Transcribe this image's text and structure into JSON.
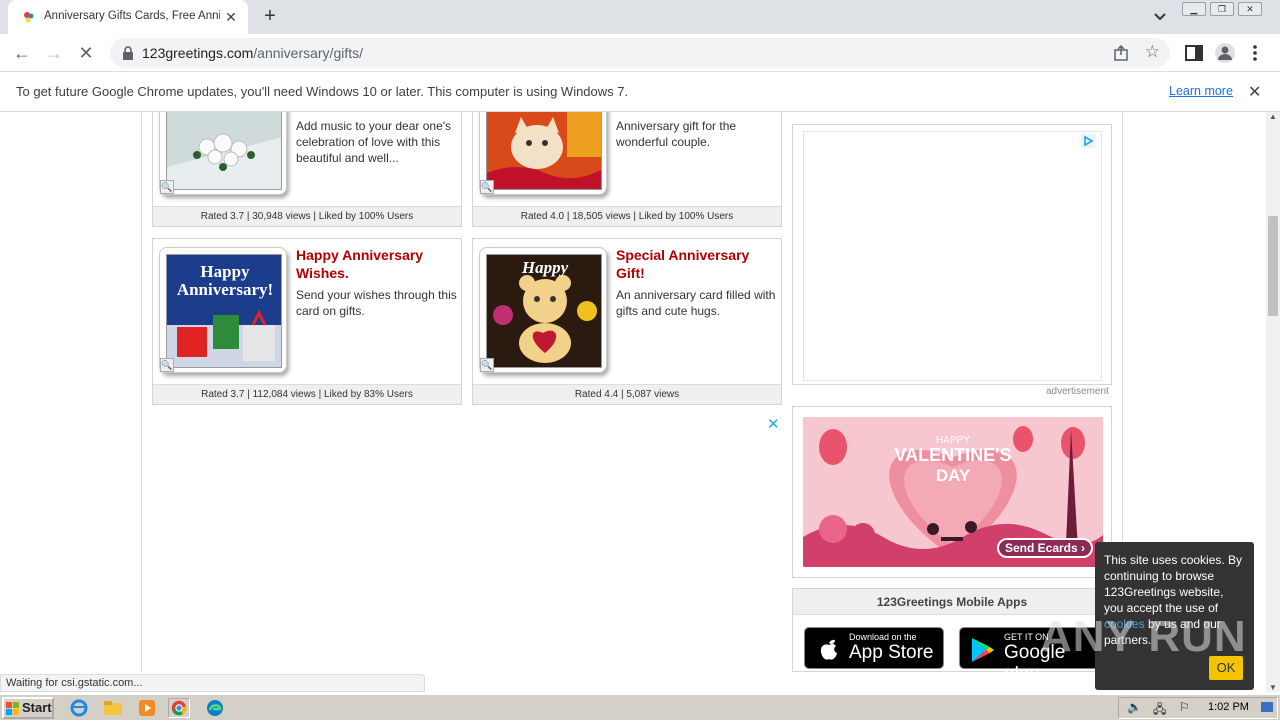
{
  "browser": {
    "tab_title": "Anniversary Gifts Cards, Free Anniv",
    "url_host": "123greetings.com",
    "url_path": "/anniversary/gifts/",
    "infobar_message": "To get future Google Chrome updates, you'll need Windows 10 or later. This computer is using Windows 7.",
    "infobar_link": "Learn more",
    "status_text": "Waiting for csi.gstatic.com..."
  },
  "cards": [
    {
      "title": "",
      "desc": "Add music to your dear one's celebration of love with this beautiful and well...",
      "rating": "Rated 3.7 | 30,948 views | Liked by 100% Users"
    },
    {
      "title": "",
      "desc": "Anniversary gift for the wonderful couple.",
      "rating": "Rated 4.0 | 18,505 views | Liked by 100% Users"
    },
    {
      "title": "Happy Anniversary Wishes.",
      "desc": "Send your wishes through this card on gifts.",
      "rating": "Rated 3.7 | 112,084 views | Liked by 83% Users",
      "thumb_text": "Happy Anniversary!"
    },
    {
      "title": "Special Anniversary Gift!",
      "desc": "An anniversary card filled with gifts and cute hugs.",
      "rating": "Rated 4.4 | 5,087 views",
      "thumb_text": "Happy"
    }
  ],
  "sidebar": {
    "ad_label": "advertisement",
    "valentine": {
      "line1": "HAPPY",
      "line2": "VALENTINE'S",
      "line3": "DAY",
      "button": "Send Ecards ›"
    },
    "apps_heading": "123Greetings Mobile Apps",
    "appstore_small": "Download on the",
    "appstore_big": "App Store",
    "googleplay_small": "GET IT ON",
    "googleplay_big": "Google play"
  },
  "cookie": {
    "text_before": "This site uses cookies. By continuing to browse 123Greetings website, you accept the use of ",
    "link": "cookies",
    "text_after": " by us and our partners.",
    "ok": "OK"
  },
  "watermark": "ANY RUN",
  "taskbar": {
    "start": "Start",
    "clock": "1:02 PM"
  },
  "colors": {
    "card_title": "#b30000",
    "link_blue": "#1a73e8",
    "cookie_ok": "#f5c400"
  }
}
